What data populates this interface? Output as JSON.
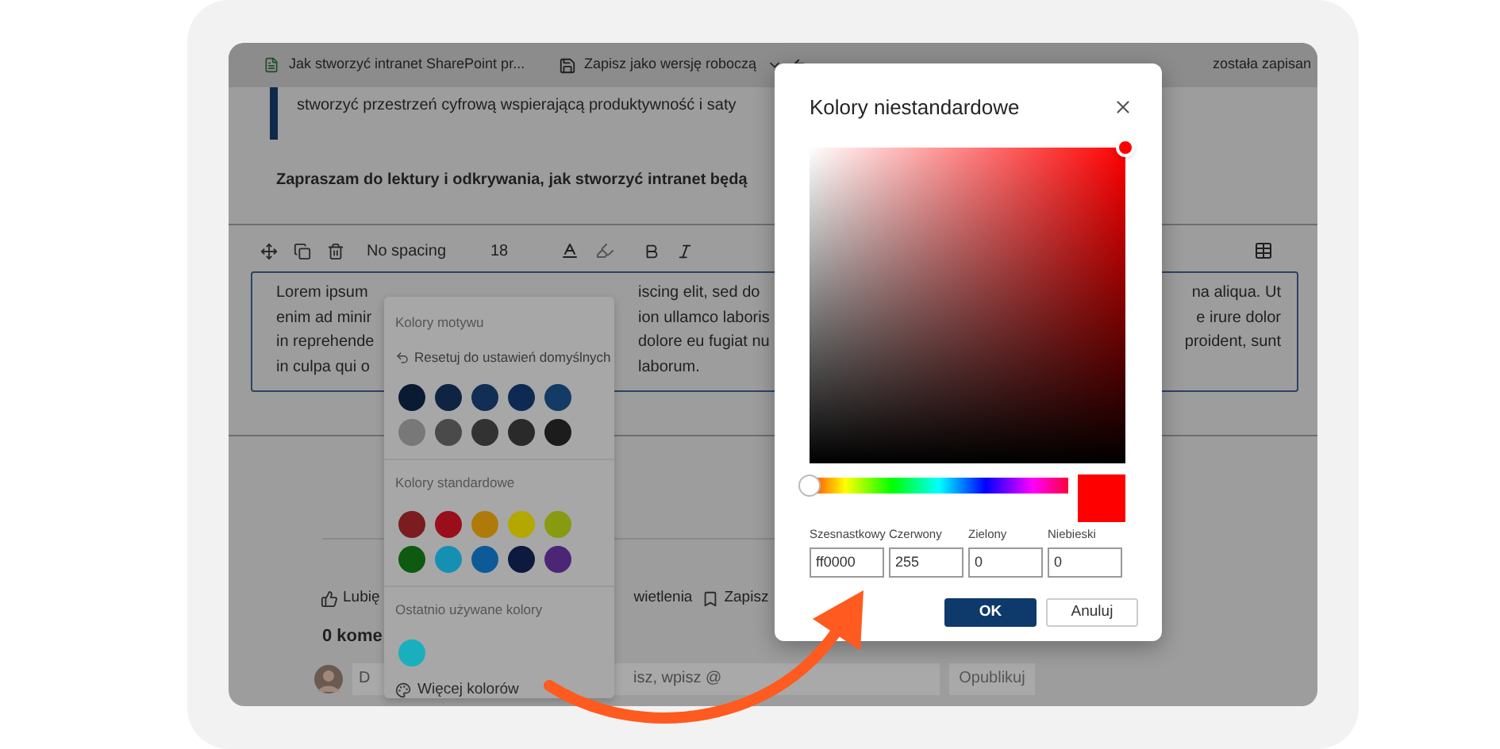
{
  "top_bar": {
    "page_title": "Jak stworzyć intranet SharePoint pr...",
    "save_draft": "Zapisz jako wersję roboczą",
    "status": "została zapisan"
  },
  "article": {
    "quote": "stworzyć przestrzeń cyfrową wspierającą produktywność i saty",
    "invitation": "Zapraszam do lektury i odkrywania, jak stworzyć intranet będą"
  },
  "toolbar": {
    "style": "No spacing",
    "font_size": "18"
  },
  "paragraph": {
    "left": [
      "Lorem ipsum",
      "enim ad minir",
      "in reprehende",
      "in culpa qui o"
    ],
    "middle": [
      "iscing elit, sed do",
      "ion ullamco laboris",
      "dolore eu fugiat nu",
      "laborum."
    ],
    "right": [
      "na aliqua. Ut",
      "e irure dolor",
      "proident, sunt"
    ]
  },
  "social": {
    "like": "Lubię",
    "views": "wietlenia",
    "save": "Zapisz",
    "comments": "0 kome",
    "comment_placeholder_start": "D",
    "comment_placeholder_end": "isz, wpisz @",
    "publish": "Opublikuj"
  },
  "color_menu": {
    "theme_title": "Kolory motywu",
    "reset": "Resetuj do ustawień domyślnych",
    "theme_colors": [
      {
        "color": "#0b1a33"
      },
      {
        "color": "#0f2442"
      },
      {
        "color": "#132e55"
      },
      {
        "color": "#0e2a52"
      },
      {
        "color": "#143a66"
      },
      {
        "color": "#787878"
      },
      {
        "color": "#4a4a4a"
      },
      {
        "color": "#323232"
      },
      {
        "color": "#2a2a2a"
      },
      {
        "color": "#1c1c1c"
      }
    ],
    "standard_title": "Kolory standardowe",
    "standard_colors": [
      {
        "color": "#7a1c20"
      },
      {
        "color": "#9a0e1c"
      },
      {
        "color": "#b07a0a"
      },
      {
        "color": "#b3a800"
      },
      {
        "color": "#889a10"
      },
      {
        "color": "#0d5a10"
      },
      {
        "color": "#1590b3"
      },
      {
        "color": "#0d5a99"
      },
      {
        "color": "#0b1a3d"
      },
      {
        "color": "#4d2577"
      }
    ],
    "recent_title": "Ostatnio używane kolory",
    "recent_colors": [
      {
        "color": "#1aafbd"
      }
    ],
    "more": "Więcej kolorów"
  },
  "dialog": {
    "title": "Kolory niestandardowe",
    "hue": {
      "level": 0
    },
    "fields": [
      {
        "label": "Szesnastkowy",
        "value": "ff0000"
      },
      {
        "label": "Czerwony",
        "value": "255"
      },
      {
        "label": "Zielony",
        "value": "0"
      },
      {
        "label": "Niebieski",
        "value": "0"
      }
    ],
    "ok": "OK",
    "cancel": "Anuluj"
  }
}
